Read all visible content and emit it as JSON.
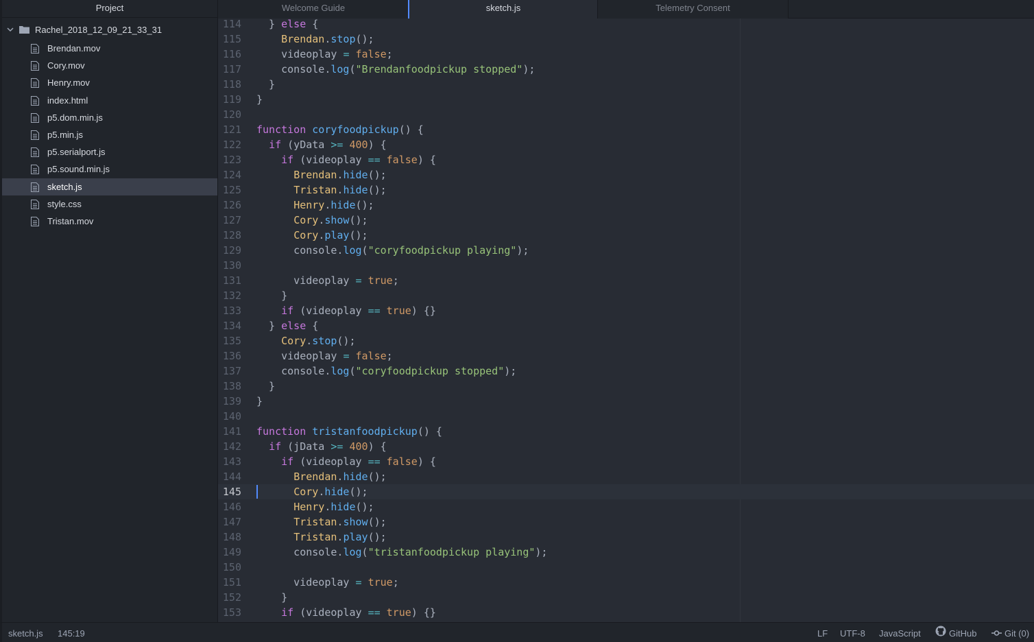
{
  "sidebar": {
    "title": "Project",
    "root_folder": "Rachel_2018_12_09_21_33_31",
    "files": [
      {
        "name": "Brendan.mov",
        "selected": false
      },
      {
        "name": "Cory.mov",
        "selected": false
      },
      {
        "name": "Henry.mov",
        "selected": false
      },
      {
        "name": "index.html",
        "selected": false
      },
      {
        "name": "p5.dom.min.js",
        "selected": false
      },
      {
        "name": "p5.min.js",
        "selected": false
      },
      {
        "name": "p5.serialport.js",
        "selected": false
      },
      {
        "name": "p5.sound.min.js",
        "selected": false
      },
      {
        "name": "sketch.js",
        "selected": true
      },
      {
        "name": "style.css",
        "selected": false
      },
      {
        "name": "Tristan.mov",
        "selected": false
      }
    ]
  },
  "tabs": [
    {
      "label": "Welcome Guide",
      "active": false
    },
    {
      "label": "sketch.js",
      "active": true
    },
    {
      "label": "Telemetry Consent",
      "active": false
    }
  ],
  "editor": {
    "cursor_line": 145,
    "lines": [
      {
        "n": "114",
        "tokens": [
          [
            "",
            "  } "
          ],
          [
            "kw",
            "else"
          ],
          [
            "",
            " {"
          ]
        ]
      },
      {
        "n": "115",
        "tokens": [
          [
            "",
            "    "
          ],
          [
            "obj",
            "Brendan"
          ],
          [
            "",
            "."
          ],
          [
            "fn",
            "stop"
          ],
          [
            "",
            "();"
          ]
        ]
      },
      {
        "n": "116",
        "tokens": [
          [
            "",
            "    videoplay "
          ],
          [
            "op",
            "="
          ],
          [
            "",
            " "
          ],
          [
            "num",
            "false"
          ],
          [
            "",
            ";"
          ]
        ]
      },
      {
        "n": "117",
        "tokens": [
          [
            "",
            "    console."
          ],
          [
            "fn",
            "log"
          ],
          [
            "",
            "("
          ],
          [
            "str",
            "\"Brendanfoodpickup stopped\""
          ],
          [
            "",
            ");"
          ]
        ]
      },
      {
        "n": "118",
        "tokens": [
          [
            "",
            "  }"
          ]
        ]
      },
      {
        "n": "119",
        "tokens": [
          [
            "",
            "}"
          ]
        ]
      },
      {
        "n": "120",
        "tokens": []
      },
      {
        "n": "121",
        "tokens": [
          [
            "kw",
            "function"
          ],
          [
            "",
            " "
          ],
          [
            "fn",
            "coryfoodpickup"
          ],
          [
            "",
            "() {"
          ]
        ]
      },
      {
        "n": "122",
        "tokens": [
          [
            "",
            "  "
          ],
          [
            "kw",
            "if"
          ],
          [
            "",
            " (yData "
          ],
          [
            "op",
            ">="
          ],
          [
            "",
            " "
          ],
          [
            "num",
            "400"
          ],
          [
            "",
            ") {"
          ]
        ]
      },
      {
        "n": "123",
        "tokens": [
          [
            "",
            "    "
          ],
          [
            "kw",
            "if"
          ],
          [
            "",
            " (videoplay "
          ],
          [
            "op",
            "=="
          ],
          [
            "",
            " "
          ],
          [
            "num",
            "false"
          ],
          [
            "",
            ") {"
          ]
        ]
      },
      {
        "n": "124",
        "tokens": [
          [
            "",
            "      "
          ],
          [
            "obj",
            "Brendan"
          ],
          [
            "",
            "."
          ],
          [
            "fn",
            "hide"
          ],
          [
            "",
            "();"
          ]
        ]
      },
      {
        "n": "125",
        "tokens": [
          [
            "",
            "      "
          ],
          [
            "obj",
            "Tristan"
          ],
          [
            "",
            "."
          ],
          [
            "fn",
            "hide"
          ],
          [
            "",
            "();"
          ]
        ]
      },
      {
        "n": "126",
        "tokens": [
          [
            "",
            "      "
          ],
          [
            "obj",
            "Henry"
          ],
          [
            "",
            "."
          ],
          [
            "fn",
            "hide"
          ],
          [
            "",
            "();"
          ]
        ]
      },
      {
        "n": "127",
        "tokens": [
          [
            "",
            "      "
          ],
          [
            "obj",
            "Cory"
          ],
          [
            "",
            "."
          ],
          [
            "fn",
            "show"
          ],
          [
            "",
            "();"
          ]
        ]
      },
      {
        "n": "128",
        "tokens": [
          [
            "",
            "      "
          ],
          [
            "obj",
            "Cory"
          ],
          [
            "",
            "."
          ],
          [
            "fn",
            "play"
          ],
          [
            "",
            "();"
          ]
        ]
      },
      {
        "n": "129",
        "tokens": [
          [
            "",
            "      console."
          ],
          [
            "fn",
            "log"
          ],
          [
            "",
            "("
          ],
          [
            "str",
            "\"coryfoodpickup playing\""
          ],
          [
            "",
            ");"
          ]
        ]
      },
      {
        "n": "130",
        "tokens": []
      },
      {
        "n": "131",
        "tokens": [
          [
            "",
            "      videoplay "
          ],
          [
            "op",
            "="
          ],
          [
            "",
            " "
          ],
          [
            "num",
            "true"
          ],
          [
            "",
            ";"
          ]
        ]
      },
      {
        "n": "132",
        "tokens": [
          [
            "",
            "    }"
          ]
        ]
      },
      {
        "n": "133",
        "tokens": [
          [
            "",
            "    "
          ],
          [
            "kw",
            "if"
          ],
          [
            "",
            " (videoplay "
          ],
          [
            "op",
            "=="
          ],
          [
            "",
            " "
          ],
          [
            "num",
            "true"
          ],
          [
            "",
            ") {}"
          ]
        ]
      },
      {
        "n": "134",
        "tokens": [
          [
            "",
            "  } "
          ],
          [
            "kw",
            "else"
          ],
          [
            "",
            " {"
          ]
        ]
      },
      {
        "n": "135",
        "tokens": [
          [
            "",
            "    "
          ],
          [
            "obj",
            "Cory"
          ],
          [
            "",
            "."
          ],
          [
            "fn",
            "stop"
          ],
          [
            "",
            "();"
          ]
        ]
      },
      {
        "n": "136",
        "tokens": [
          [
            "",
            "    videoplay "
          ],
          [
            "op",
            "="
          ],
          [
            "",
            " "
          ],
          [
            "num",
            "false"
          ],
          [
            "",
            ";"
          ]
        ]
      },
      {
        "n": "137",
        "tokens": [
          [
            "",
            "    console."
          ],
          [
            "fn",
            "log"
          ],
          [
            "",
            "("
          ],
          [
            "str",
            "\"coryfoodpickup stopped\""
          ],
          [
            "",
            ");"
          ]
        ]
      },
      {
        "n": "138",
        "tokens": [
          [
            "",
            "  }"
          ]
        ]
      },
      {
        "n": "139",
        "tokens": [
          [
            "",
            "}"
          ]
        ]
      },
      {
        "n": "140",
        "tokens": []
      },
      {
        "n": "141",
        "tokens": [
          [
            "kw",
            "function"
          ],
          [
            "",
            " "
          ],
          [
            "fn",
            "tristanfoodpickup"
          ],
          [
            "",
            "() {"
          ]
        ]
      },
      {
        "n": "142",
        "tokens": [
          [
            "",
            "  "
          ],
          [
            "kw",
            "if"
          ],
          [
            "",
            " (jData "
          ],
          [
            "op",
            ">="
          ],
          [
            "",
            " "
          ],
          [
            "num",
            "400"
          ],
          [
            "",
            ") {"
          ]
        ]
      },
      {
        "n": "143",
        "tokens": [
          [
            "",
            "    "
          ],
          [
            "kw",
            "if"
          ],
          [
            "",
            " (videoplay "
          ],
          [
            "op",
            "=="
          ],
          [
            "",
            " "
          ],
          [
            "num",
            "false"
          ],
          [
            "",
            ") {"
          ]
        ]
      },
      {
        "n": "144",
        "tokens": [
          [
            "",
            "      "
          ],
          [
            "obj",
            "Brendan"
          ],
          [
            "",
            "."
          ],
          [
            "fn",
            "hide"
          ],
          [
            "",
            "();"
          ]
        ]
      },
      {
        "n": "145",
        "tokens": [
          [
            "",
            "      "
          ],
          [
            "obj",
            "Cory"
          ],
          [
            "",
            "."
          ],
          [
            "fn",
            "hide"
          ],
          [
            "",
            "();"
          ]
        ]
      },
      {
        "n": "146",
        "tokens": [
          [
            "",
            "      "
          ],
          [
            "obj",
            "Henry"
          ],
          [
            "",
            "."
          ],
          [
            "fn",
            "hide"
          ],
          [
            "",
            "();"
          ]
        ]
      },
      {
        "n": "147",
        "tokens": [
          [
            "",
            "      "
          ],
          [
            "obj",
            "Tristan"
          ],
          [
            "",
            "."
          ],
          [
            "fn",
            "show"
          ],
          [
            "",
            "();"
          ]
        ]
      },
      {
        "n": "148",
        "tokens": [
          [
            "",
            "      "
          ],
          [
            "obj",
            "Tristan"
          ],
          [
            "",
            "."
          ],
          [
            "fn",
            "play"
          ],
          [
            "",
            "();"
          ]
        ]
      },
      {
        "n": "149",
        "tokens": [
          [
            "",
            "      console."
          ],
          [
            "fn",
            "log"
          ],
          [
            "",
            "("
          ],
          [
            "str",
            "\"tristanfoodpickup playing\""
          ],
          [
            "",
            ");"
          ]
        ]
      },
      {
        "n": "150",
        "tokens": []
      },
      {
        "n": "151",
        "tokens": [
          [
            "",
            "      videoplay "
          ],
          [
            "op",
            "="
          ],
          [
            "",
            " "
          ],
          [
            "num",
            "true"
          ],
          [
            "",
            ";"
          ]
        ]
      },
      {
        "n": "152",
        "tokens": [
          [
            "",
            "    }"
          ]
        ]
      },
      {
        "n": "153",
        "tokens": [
          [
            "",
            "    "
          ],
          [
            "kw",
            "if"
          ],
          [
            "",
            " (videoplay "
          ],
          [
            "op",
            "=="
          ],
          [
            "",
            " "
          ],
          [
            "num",
            "true"
          ],
          [
            "",
            ") {}"
          ]
        ]
      }
    ]
  },
  "statusbar": {
    "file": "sketch.js",
    "position": "145:19",
    "line_ending": "LF",
    "encoding": "UTF-8",
    "grammar": "JavaScript",
    "github": "GitHub",
    "git": "Git (0)"
  },
  "icons": {
    "folder": "folder-icon",
    "file": "file-text-icon",
    "chevron": "chevron-down-icon",
    "github": "github-icon",
    "git": "git-commit-icon"
  },
  "colors": {
    "accent": "#528bff",
    "keyword": "#c678dd",
    "function": "#61afef",
    "object": "#e5c07b",
    "string": "#98c379",
    "number": "#d19a66",
    "operator": "#56b6c2"
  }
}
